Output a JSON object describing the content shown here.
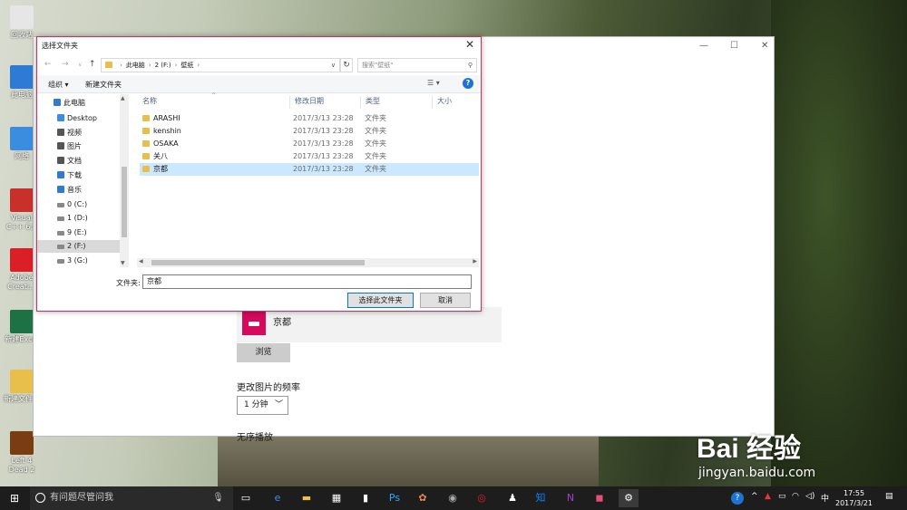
{
  "desktop": {
    "icons": [
      {
        "label": "回收站",
        "color": "#e6e6e6"
      },
      {
        "label": "此电脑",
        "color": "#2e7bd6"
      },
      {
        "label": "网络",
        "color": "#3b8de0"
      },
      {
        "label": "Visual C++ 6.0",
        "color": "#c9302c"
      },
      {
        "label": "Adobe Creati...",
        "color": "#da1f26"
      },
      {
        "label": "新建Excel",
        "color": "#1e7145"
      },
      {
        "label": "新建文件夹",
        "color": "#e8bf4b"
      },
      {
        "label": "Left 4 Dead 2",
        "color": "#7a3d12"
      }
    ]
  },
  "settings": {
    "selected_folder": "京都",
    "browse_label": "浏览",
    "frequency_label": "更改图片的频率",
    "frequency_value": "1 分钟",
    "shuffle_label": "无序播放",
    "minimize": "—",
    "maximize": "☐",
    "close": "✕"
  },
  "dialog": {
    "title": "选择文件夹",
    "close": "✕",
    "breadcrumb": [
      "此电脑",
      "2 (F:)",
      "壁纸"
    ],
    "search_placeholder": "搜索\"壁纸\"",
    "toolbar": {
      "organize": "组织 ▾",
      "new_folder": "新建文件夹",
      "help": "?"
    },
    "tree": [
      {
        "label": "此电脑",
        "color": "#2e7bd6"
      },
      {
        "label": "Desktop",
        "color": "#3b8de0"
      },
      {
        "label": "视频",
        "color": "#555"
      },
      {
        "label": "图片",
        "color": "#555"
      },
      {
        "label": "文档",
        "color": "#555"
      },
      {
        "label": "下载",
        "color": "#2e7bd6"
      },
      {
        "label": "音乐",
        "color": "#2e7bd6"
      },
      {
        "label": "0 (C:)",
        "color": "#888"
      },
      {
        "label": "1 (D:)",
        "color": "#888"
      },
      {
        "label": "9 (E:)",
        "color": "#888"
      },
      {
        "label": "2 (F:)",
        "color": "#888"
      },
      {
        "label": "3 (G:)",
        "color": "#888"
      }
    ],
    "selected_tree_item": "2 (F:)",
    "columns": [
      "名称",
      "修改日期",
      "类型",
      "大小"
    ],
    "rows": [
      {
        "name": "ARASHI",
        "date": "2017/3/13 23:28",
        "type": "文件夹"
      },
      {
        "name": "kenshin",
        "date": "2017/3/13 23:28",
        "type": "文件夹"
      },
      {
        "name": "OSAKA",
        "date": "2017/3/13 23:28",
        "type": "文件夹"
      },
      {
        "name": "关八",
        "date": "2017/3/13 23:28",
        "type": "文件夹"
      },
      {
        "name": "京都",
        "date": "2017/3/13 23:28",
        "type": "文件夹"
      }
    ],
    "selected_row": "京都",
    "folder_label": "文件夹:",
    "folder_value": "京都",
    "ok_label": "选择此文件夹",
    "cancel_label": "取消"
  },
  "watermark": {
    "brand": "Bai 经验",
    "url": "jingyan.baidu.com"
  },
  "taskbar": {
    "search_placeholder": "有问题尽管问我",
    "start_icon": "⊞",
    "apps": [
      {
        "name": "task-view-icon",
        "glyph": "▭",
        "color": "#fff"
      },
      {
        "name": "edge-icon",
        "glyph": "e",
        "color": "#3c8fe0"
      },
      {
        "name": "file-explorer-icon",
        "glyph": "▬",
        "color": "#f0c14b"
      },
      {
        "name": "store-icon",
        "glyph": "▦",
        "color": "#fff"
      },
      {
        "name": "notes-icon",
        "glyph": "▮",
        "color": "#fff"
      },
      {
        "name": "photoshop-icon",
        "glyph": "Ps",
        "color": "#31a8ff"
      },
      {
        "name": "photo-app-icon",
        "glyph": "✿",
        "color": "#e84"
      },
      {
        "name": "camera-icon",
        "glyph": "◉",
        "color": "#aaa"
      },
      {
        "name": "netease-music-icon",
        "glyph": "◎",
        "color": "#e02020"
      },
      {
        "name": "qq-icon",
        "glyph": "♟",
        "color": "#fff"
      },
      {
        "name": "zhihu-icon",
        "glyph": "知",
        "color": "#0a84ff"
      },
      {
        "name": "onenote-icon",
        "glyph": "N",
        "color": "#a33fd0"
      },
      {
        "name": "app-pink-icon",
        "glyph": "◼",
        "color": "#e2507a"
      },
      {
        "name": "settings-icon",
        "glyph": "⚙",
        "color": "#fff"
      }
    ],
    "tray": {
      "input": "中",
      "time": "17:55",
      "date": "2017/3/21"
    }
  }
}
